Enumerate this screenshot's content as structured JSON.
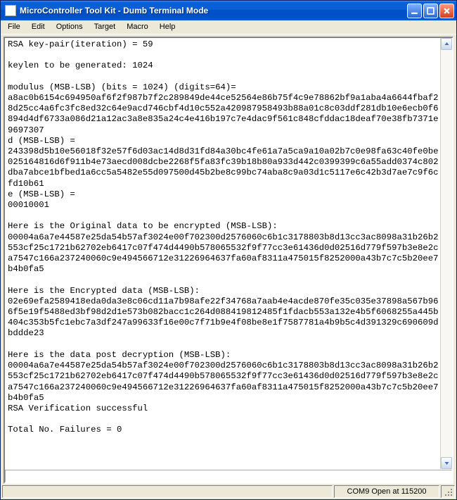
{
  "window": {
    "title": "MicroController Tool Kit - Dumb Terminal Mode"
  },
  "menu": {
    "items": [
      "File",
      "Edit",
      "Options",
      "Target",
      "Macro",
      "Help"
    ]
  },
  "status": {
    "left": "",
    "connection": "COM9 Open at 115200"
  },
  "terminal": {
    "lines": [
      "RSA key-pair(iteration) = 59",
      "",
      "keylen to be generated: 1024",
      "",
      "modulus (MSB-LSB) (bits = 1024) (digits=64)=",
      "a8ac0b6154c694950af6f2f987b7f2c289849de44ce52564e86b75f4c9e78862bf9a1aba4a6644fbaf28d25cc4a6fc3fc8ed32c64e9acd746cbf4d10c552a420987958493b88a01c8c03ddf281db10e6ecb0f6894d4df6733a086d21a12ac3a8e835a24c4e416b197c7e4dac9f561c848cfddac18deaf70e38fb7371e9697307",
      "d (MSB-LSB) =",
      "243398d5b10e56018f32e57f6d03ac14d8d31fd84a30bc4fe61a7a5ca9a10a02b7c0e98fa63c40fe0be025164816d6f911b4e73aecd008dcbe2268f5fa83fc39b18b80a933d442c0399399c6a55add0374c802dba7abce1bfbed1a6cc5a5482e55d097500d45b2be8c99bc74aba8c9a03d1c5117e6c42b3d7ae7c9f6cfd10b61",
      "e (MSB-LSB) =",
      "00010001",
      "",
      "Here is the Original data to be encrypted (MSB-LSB):",
      "00004a6a7e44587e25da54b57af3024e00f702300d2576060c6b1c3178803b8d13cc3ac8098a31b26b2553cf25c1721b62702eb6417c07f474d4490b578065532f9f77cc3e61436d0d02516d779f597b3e8e2ca7547c166a237240060c9e494566712e31226964637fa60af8311a475015f8252000a43b7c7c5b20ee7b4b0fa5",
      "",
      "Here is the Encrypted data (MSB-LSB):",
      "02e69efa2589418eda0da3e8c06cd11a7b98afe22f34768a7aab4e4acde870fe35c035e37898a567b966f5e19f5488ed3bf98d2d1e573b082bacc1c264d088419812485f1fdacb553a132e4b5f6068255a445b404c353b5fc1ebc7a3df247a99633f16e00c7f71b9e4f08be8e1f7587781a4b9b5c4d391329c690609dbddde23",
      "",
      "Here is the data post decryption (MSB-LSB):",
      "00004a6a7e44587e25da54b57af3024e00f702300d2576060c6b1c3178803b8d13cc3ac8098a31b26b2553cf25c1721b62702eb6417c07f474d4490b578065532f9f77cc3e61436d0d02516d779f597b3e8e2ca7547c166a237240060c9e494566712e31226964637fa60af8311a475015f8252000a43b7c7c5b20ee7b4b0fa5",
      "RSA Verification successful",
      "",
      "Total No. Failures = 0",
      ""
    ]
  }
}
